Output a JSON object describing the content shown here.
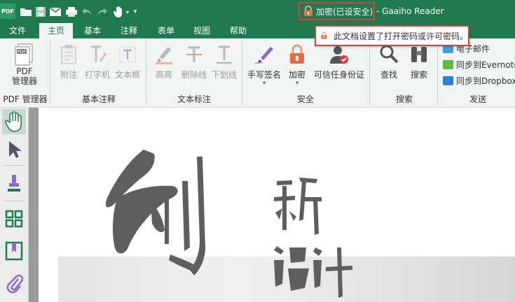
{
  "titlebar": {
    "app_logo": "PDF",
    "quick_access_icons": [
      "open-folder-icon",
      "save-icon",
      "email-icon",
      "print-icon",
      "undo-icon",
      "redo-icon",
      "hand-tool-icon",
      "customize-dropdown-icon"
    ],
    "security_status": "加密(已设安全)",
    "app_title": "- Gaaiho Reader"
  },
  "tabs": [
    {
      "label": "文件",
      "active": false
    },
    {
      "label": "主页",
      "active": true
    },
    {
      "label": "基本",
      "active": false
    },
    {
      "label": "注释",
      "active": false
    },
    {
      "label": "表单",
      "active": false
    },
    {
      "label": "视图",
      "active": false
    },
    {
      "label": "帮助",
      "active": false
    }
  ],
  "tooltip": {
    "text": "此文档设置了打开密码或许可密码。"
  },
  "ribbon": {
    "pdf_manager": {
      "line1": "PDF",
      "line2": "管理器",
      "group": "PDF 管理器"
    },
    "basic_annotation": {
      "group": "基本注释",
      "items": [
        {
          "label": "附注",
          "icon": "sticky-note-icon",
          "enabled": false
        },
        {
          "label": "打字机",
          "icon": "typewriter-icon",
          "enabled": false
        },
        {
          "label": "文本框",
          "icon": "text-box-icon",
          "enabled": false
        }
      ]
    },
    "text_markup": {
      "group": "文本标注",
      "items": [
        {
          "label": "高亮",
          "icon": "highlight-icon",
          "enabled": false
        },
        {
          "label": "删除线",
          "icon": "strikethrough-icon",
          "enabled": false
        },
        {
          "label": "下划线",
          "icon": "underline-icon",
          "enabled": false
        }
      ]
    },
    "security": {
      "group": "安全",
      "items": [
        {
          "label": "手写签名",
          "icon": "pen-signature-icon"
        },
        {
          "label": "加密",
          "icon": "lock-icon"
        },
        {
          "label": "可信任身份证",
          "icon": "trusted-id-icon"
        }
      ]
    },
    "search": {
      "group": "搜索",
      "items": [
        {
          "label": "查找",
          "icon": "magnifier-icon"
        },
        {
          "label": "搜索",
          "icon": "binoculars-icon"
        }
      ]
    },
    "send": {
      "group": "发送",
      "items": [
        {
          "label": "电子邮件",
          "icon": "email-icon"
        },
        {
          "label": "同步到Evernote",
          "icon": "evernote-icon"
        },
        {
          "label": "同步到Dropbox",
          "icon": "dropbox-icon"
        }
      ]
    }
  },
  "sidebar_tools": [
    "hand-tool-icon",
    "select-arrow-icon",
    "stamp-icon",
    "thumbnails-icon",
    "bookmark-icon",
    "attachment-icon"
  ],
  "document": {
    "title_line1": "创",
    "title_line2": "新",
    "title_line3": "设计"
  },
  "colors": {
    "brand_green": "#1f7a4f",
    "alert_red": "#e23b3b",
    "ribbon_bg": "#f1f4f2"
  }
}
